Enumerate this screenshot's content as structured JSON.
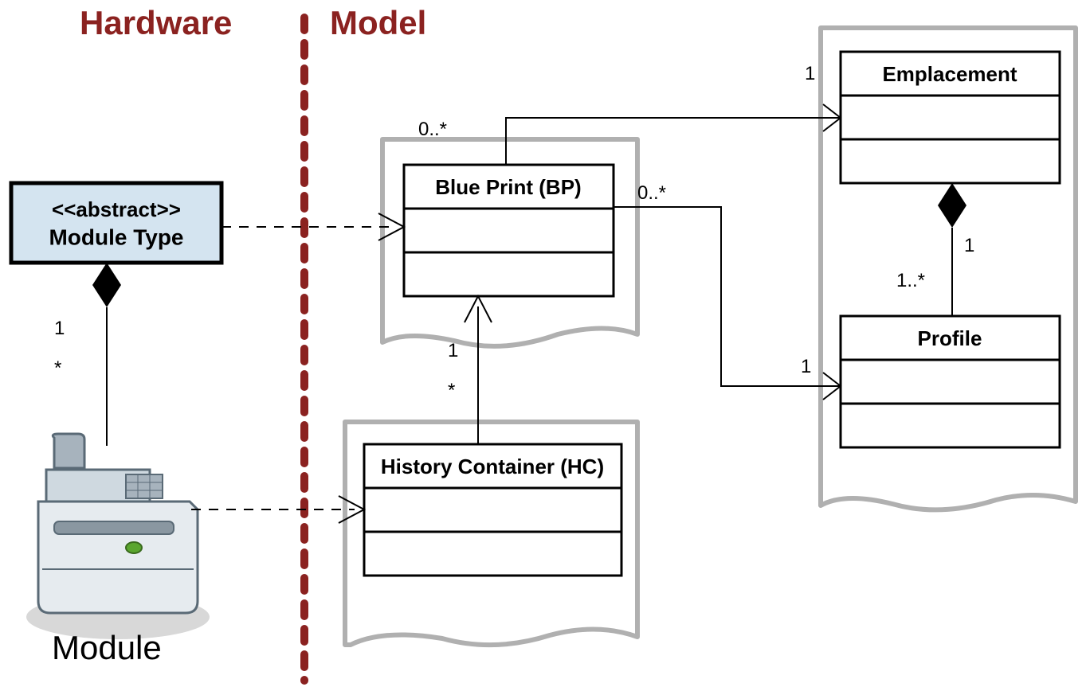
{
  "sections": {
    "hardware": "Hardware",
    "model": "Model"
  },
  "classes": {
    "moduleType": {
      "stereotype": "<<abstract>>",
      "name": "Module Type"
    },
    "bluePrint": {
      "name": "Blue Print (BP)"
    },
    "historyContainer": {
      "name": "History Container (HC)"
    },
    "emplacement": {
      "name": "Emplacement"
    },
    "profile": {
      "name": "Profile"
    }
  },
  "moduleImage": {
    "label": "Module"
  },
  "multiplicities": {
    "moduleType_to_module_top": "1",
    "moduleType_to_module_bottom": "*",
    "bp_to_emplacement_left": "0..*",
    "bp_to_emplacement_right": "1",
    "bp_to_profile_left": "0..*",
    "bp_to_profile_right": "1",
    "hc_to_bp_top": "1",
    "hc_to_bp_bottom": "*",
    "emplacement_to_profile_top": "1",
    "emplacement_to_profile_bottom": "1..*"
  }
}
